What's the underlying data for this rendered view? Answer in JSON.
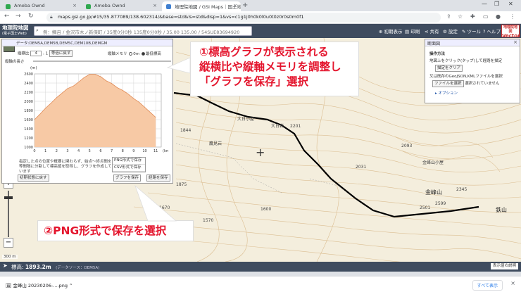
{
  "browser": {
    "tabs": [
      {
        "label": "Ameba Ownd",
        "color": "#2fa84f"
      },
      {
        "label": "Ameba Ownd",
        "color": "#2fa84f"
      },
      {
        "label": "地理院地図 / GSI Maps｜国土地",
        "color": "#3f7fd0"
      }
    ],
    "new_tab": "+",
    "url": "maps.gsi.go.jp/#15/35.877089/138.602314/&base=std&ls=std&disp=1&vs=c1g1j0h0k0l0u0t0z0r0s0m0f1"
  },
  "gsi": {
    "logo_main": "地理院地図",
    "logo_sub": "(電子国土Web)",
    "search_text": "例：鯛呂 / 金沢市木ノ新保町 / 35度0分0秒 135度0分0秒 / 35.00 135.00 / 54SUE83694920",
    "buttons": {
      "init": "初期表示",
      "print": "印刷",
      "share": "共有",
      "settings": "設定",
      "tools": "ツール",
      "help": "ヘルプ"
    },
    "vector_badge_top": "地理院地図",
    "vector_badge_bottom": "Vector"
  },
  "graph_panel": {
    "header": "データ:DEM5A,DEM5B,DEM5C,DEM10B,DEMGM",
    "ratio_label": "縦横比",
    "ratio_value": "4",
    "ratio_sep": ": 1",
    "ratio_btn": "等倍に戻す",
    "vaxis_label": "縦軸メモリ",
    "vaxis_opt1": "0m",
    "vaxis_opt2": "最低標高",
    "length_label": "縦軸の長さ",
    "unit_m": "(m)",
    "unit_km": "(km)",
    "desc": "指定した点の位置や概要に関わらず、始点～終点間を等間隔に分割して標高値を取得し、グラフを作成しています",
    "desc_suffix": "の標高値より",
    "save_menu": [
      "PNG形式で保存",
      "CSV形式で保存"
    ],
    "save_graph_btn": "グラフを保存",
    "save_route_btn": "経路を保存",
    "reset_btn": "初期状態に戻す"
  },
  "side_panel": {
    "title": "断面図",
    "close": "×",
    "section": "操作方法",
    "line1": "地図上をクリック(タップ)して経路を描定",
    "clear_btn": "描定をクリア",
    "line2": "又は既存のGeoJSON,KMLファイルを選択",
    "file_btn": "ファイルを選択",
    "file_status": "選択されていません",
    "option": "▸ オプション"
  },
  "callouts": {
    "c1_line1": "①標高グラフが表示される",
    "c1_line2": "縦横比や縦軸メモリを調整し",
    "c1_line3": "「グラフを保存」選択",
    "c2": "②PNG形式で保存を選択"
  },
  "map_labels": {
    "daibosatsu": "大日小屋",
    "dainichiiwa": "大日岩",
    "takamine": "鷹見岩",
    "kinpu_hut": "金峰山小屋",
    "kinpusan": "金峰山",
    "tetsuzan": "鉄山",
    "e1844": "1844",
    "e2201": "2201",
    "e2031": "2031",
    "e2093": "2093",
    "e2599": "2599",
    "e1670": "1670",
    "e1570": "1570",
    "e1600": "1600",
    "e1875": "1875",
    "e2501": "2501",
    "e2345": "2345"
  },
  "zoom": {
    "plus": "+",
    "minus": "−"
  },
  "scale": "300 m",
  "status": {
    "label": "標高:",
    "elevation": "1893.2m",
    "source": "(データソース：DEM5A)",
    "explain_btn": "表示値の説明"
  },
  "downloads": {
    "file": "金峰山 20230206-....png",
    "show_all": "すべて表示",
    "close": "×"
  },
  "chart_data": {
    "type": "area",
    "x": [
      0,
      0.5,
      1,
      1.5,
      2,
      2.5,
      3,
      3.5,
      4,
      4.5,
      5,
      5.5,
      6,
      6.5,
      7,
      7.5,
      8,
      8.5,
      9,
      9.5,
      10,
      10.5,
      11
    ],
    "y": [
      1600,
      1720,
      1850,
      1960,
      2080,
      2180,
      2280,
      2330,
      2420,
      2520,
      2590,
      2590,
      2540,
      2450,
      2390,
      2300,
      2240,
      2160,
      2060,
      1980,
      1870,
      1760,
      1650
    ],
    "xticks": [
      0,
      1,
      2,
      3,
      4,
      5,
      6,
      7,
      8,
      9,
      10,
      11
    ],
    "yticks": [
      1000,
      1200,
      1400,
      1600,
      1800,
      2000,
      2200,
      2400,
      2600
    ],
    "xlim": [
      0,
      11.5
    ],
    "ylim": [
      1000,
      2600
    ],
    "xunit": "(km)",
    "yunit": "(m)",
    "fill": "#f7c9a5",
    "stroke": "#e08a55",
    "grid": true
  }
}
